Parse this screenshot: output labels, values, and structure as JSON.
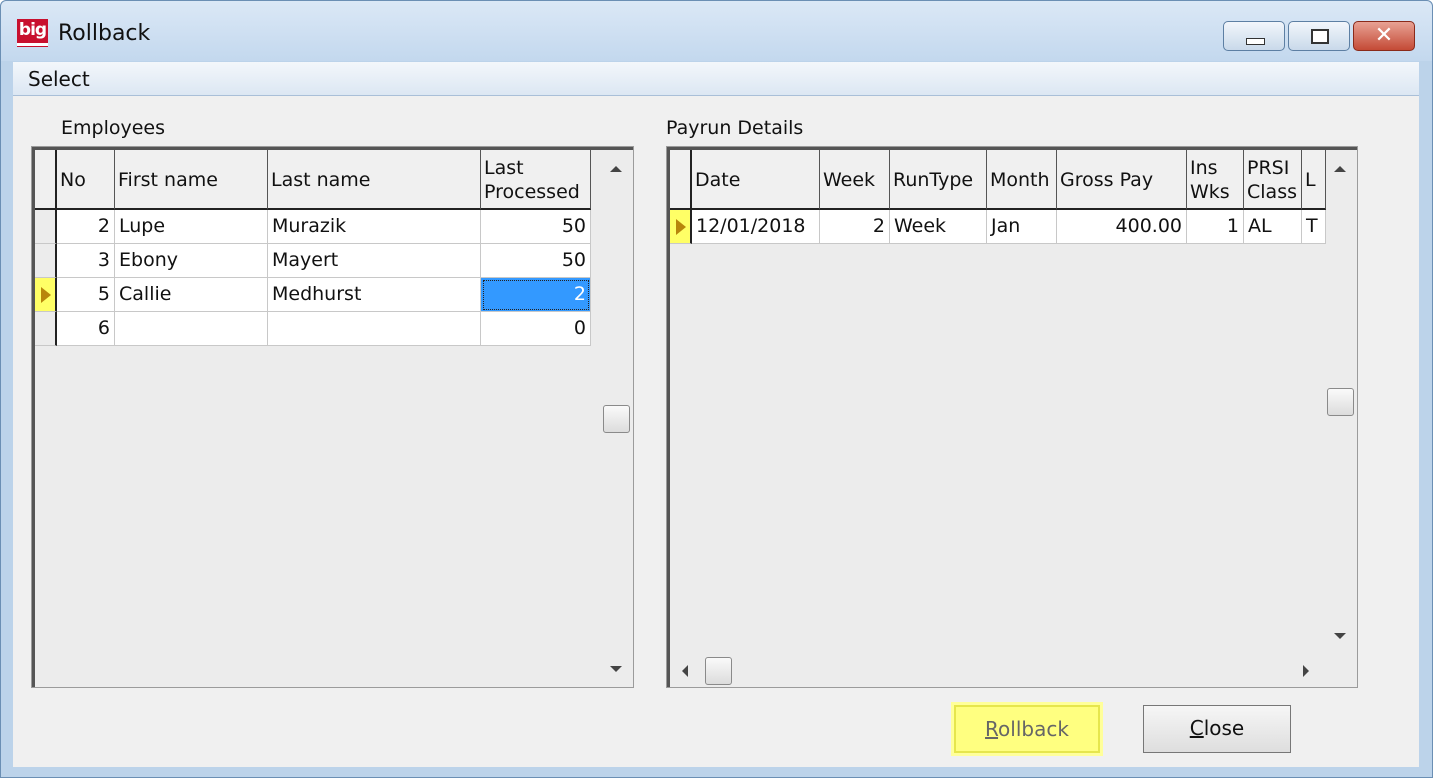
{
  "window": {
    "title": "Rollback",
    "app_icon_text": "big",
    "close_glyph": "✕"
  },
  "menu": {
    "items": [
      "Select"
    ]
  },
  "employees": {
    "label": "Employees",
    "columns": [
      "No",
      "First name",
      "Last name",
      "Last Processed"
    ],
    "rows": [
      {
        "no": "2",
        "first": "Lupe",
        "last": "Murazik",
        "processed": "50"
      },
      {
        "no": "3",
        "first": "Ebony",
        "last": "Mayert",
        "processed": "50"
      },
      {
        "no": "5",
        "first": "Callie",
        "last": "Medhurst",
        "processed": "2"
      },
      {
        "no": "6",
        "first": "",
        "last": "",
        "processed": "0"
      }
    ],
    "current_row": 3
  },
  "payrun": {
    "label": "Payrun Details",
    "columns": [
      "Date",
      "Week",
      "RunType",
      "Month",
      "Gross Pay",
      "Ins Wks",
      "PRSI Class",
      "L"
    ],
    "rows": [
      {
        "date": "12/01/2018",
        "week": "2",
        "runtype": "Week",
        "month": "Jan",
        "gross": "400.00",
        "inswks": "1",
        "prsi": "AL",
        "l": "T"
      }
    ]
  },
  "buttons": {
    "rollback": {
      "hot": "R",
      "rest": "ollback"
    },
    "close": {
      "hot": "C",
      "rest": "lose"
    }
  },
  "colors": {
    "highlight": "#ffff66",
    "selection": "#3399ff"
  }
}
